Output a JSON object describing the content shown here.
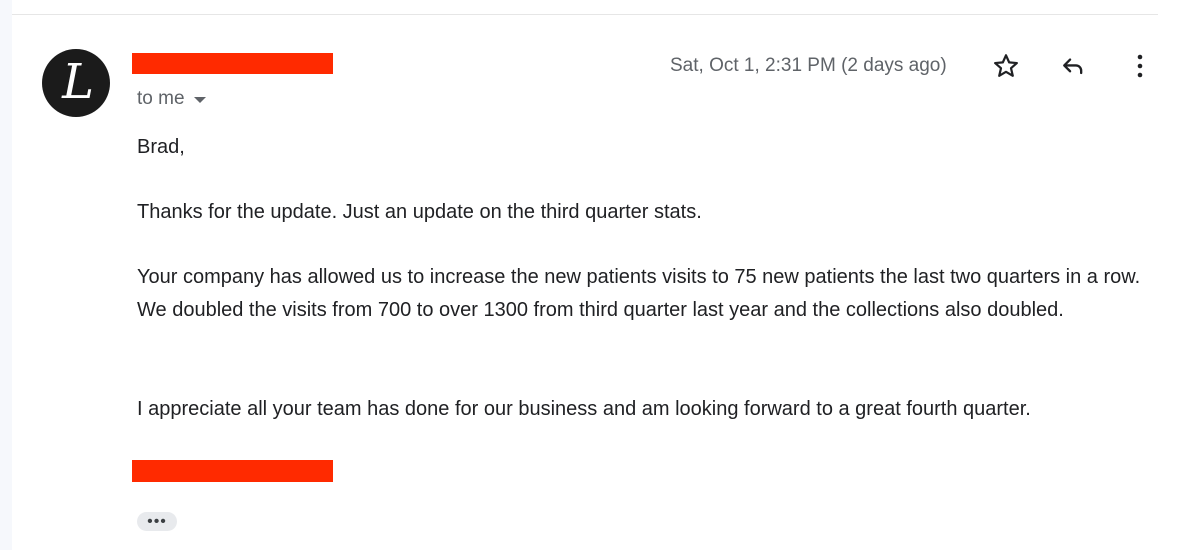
{
  "email": {
    "sender_initial": "L",
    "recipient_label": "to me",
    "timestamp": "Sat, Oct 1, 2:31 PM (2 days ago)",
    "paragraphs": [
      "Brad,",
      "Thanks for the update. Just an update on the third quarter stats.",
      "Your company has allowed us to increase the new patients visits to 75 new patients the last two quarters in a row. We doubled the visits from 700 to over 1300 from third quarter last year and the collections also doubled.",
      "I appreciate all your team has done for our business and am looking forward to a great fourth quarter."
    ],
    "trimmed_content_label": "•••"
  },
  "icons": {
    "star": "star-outline-icon",
    "reply": "reply-icon",
    "more": "more-vert-icon",
    "recipient_dropdown": "caret-down-icon"
  },
  "colors": {
    "redaction": "#ff2a00",
    "avatar_bg": "#1b1b1b",
    "secondary_text": "#5f6368",
    "primary_text": "#202124"
  }
}
